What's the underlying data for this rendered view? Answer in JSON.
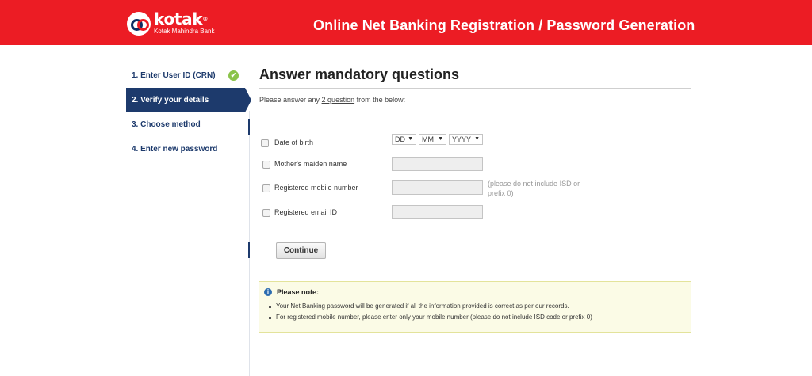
{
  "header": {
    "logo_name": "kotak",
    "logo_reg": "®",
    "logo_sub": "Kotak Mahindra Bank",
    "title": "Online Net Banking Registration / Password Generation",
    "bg_color": "#ec1c24"
  },
  "steps": [
    {
      "label": "1. Enter User ID (CRN)",
      "status": "completed",
      "check_icon": "✔"
    },
    {
      "label": "2. Verify your details",
      "status": "active"
    },
    {
      "label": "3. Choose method",
      "status": "pending"
    },
    {
      "label": "4. Enter new password",
      "status": "pending"
    }
  ],
  "main": {
    "title": "Answer mandatory questions",
    "instruction_prefix": "Please answer any ",
    "instruction_count": "2 question",
    "instruction_suffix": " from the below:"
  },
  "questions": {
    "dob": {
      "label": "Date of birth",
      "dd": "DD",
      "mm": "MM",
      "yyyy": "YYYY",
      "arrow": "▼"
    },
    "maiden": {
      "label": "Mother's maiden name",
      "value": ""
    },
    "mobile": {
      "label": "Registered mobile number",
      "value": "",
      "hint": "(please do not include ISD or prefix 0)"
    },
    "email": {
      "label": "Registered email ID",
      "value": ""
    }
  },
  "continue_label": "Continue",
  "note": {
    "title": "Please note:",
    "info_icon": "i",
    "items": [
      "Your Net Banking password will be generated if all the information provided is correct as per our records.",
      "For registered mobile number, please enter only your mobile number (please do not include ISD code or prefix 0)"
    ]
  },
  "colors": {
    "accent": "#ec1c24",
    "nav": "#1d3a6c",
    "check": "#8bc34a",
    "note_bg": "#fbfbe6"
  }
}
